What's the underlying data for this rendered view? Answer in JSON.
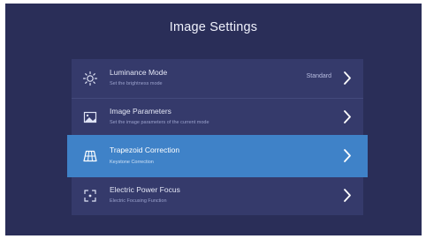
{
  "header": {
    "title": "Image Settings"
  },
  "menu": {
    "items": [
      {
        "label": "Luminance Mode",
        "subtitle": "Set the brightness mode",
        "value": "Standard",
        "icon": "sun-icon"
      },
      {
        "label": "Image Parameters",
        "subtitle": "Set the image parameters of the current mode",
        "icon": "image-params-icon"
      },
      {
        "label": "Trapezoid Correction",
        "subtitle": "Keystone Correction",
        "icon": "trapezoid-icon",
        "selected": true
      },
      {
        "label": "Electric Power Focus",
        "subtitle": "Electric Focusing Function",
        "icon": "focus-icon"
      }
    ]
  },
  "colors": {
    "background": "#2a2e58",
    "panel": "#353a6b",
    "selected": "#3f82c8"
  }
}
